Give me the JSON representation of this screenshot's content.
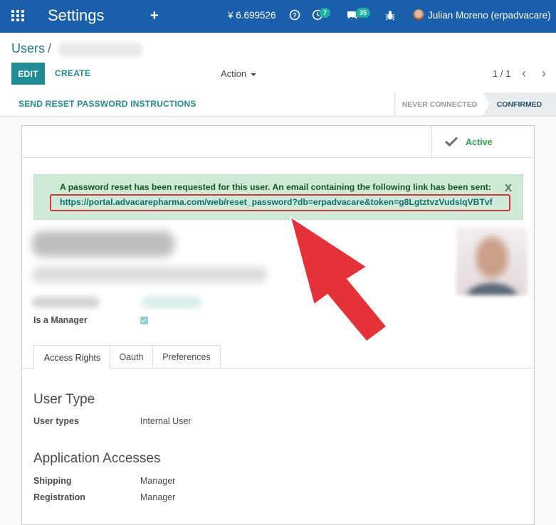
{
  "navbar": {
    "app_title": "Settings",
    "plus_label": "+",
    "balance": "¥ 6.699526",
    "activity_count": "7",
    "messages_count": "35",
    "user_name": "Julian Moreno (erpadvacare)",
    "icons": [
      "apps-grid-icon",
      "plus-icon",
      "help-icon",
      "activity-clock-icon",
      "chat-icon",
      "bug-icon",
      "user-avatar"
    ]
  },
  "control_panel": {
    "breadcrumb_parent": "Users",
    "breadcrumb_sep": "/",
    "edit_label": "EDIT",
    "create_label": "CREATE",
    "action_label": "Action",
    "pager": "1 / 1",
    "pager_prev": "‹",
    "pager_next": "›"
  },
  "statusbar": {
    "reset_label": "SEND RESET PASSWORD INSTRUCTIONS",
    "stages": [
      "NEVER CONNECTED",
      "CONFIRMED"
    ],
    "current_stage": "CONFIRMED"
  },
  "sheet": {
    "active_label": "Active",
    "alert": {
      "message": "A password reset has been requested for this user. An email containing the following link has been sent:",
      "link": "https://portal.advacarepharma.com/web/reset_password?db=erpadvacare&token=g8LgtztvzVudslqVBTvf",
      "close": "X"
    },
    "is_manager_label": "Is a Manager",
    "is_manager_checked": true,
    "tabs": [
      "Access Rights",
      "Oauth",
      "Preferences"
    ],
    "active_tab": "Access Rights",
    "user_type_title": "User Type",
    "user_types_label": "User types",
    "user_types_value": "Internal User",
    "app_access_title": "Application Accesses",
    "shipping_label": "Shipping",
    "shipping_value": "Manager",
    "registration_label": "Registration",
    "registration_value": "Manager"
  },
  "colors": {
    "navbar": "#1a5fac",
    "primary": "#1f8d94",
    "alert_bg": "#cfe9d7",
    "annotation_red": "#e53238",
    "active_green": "#28a745"
  }
}
